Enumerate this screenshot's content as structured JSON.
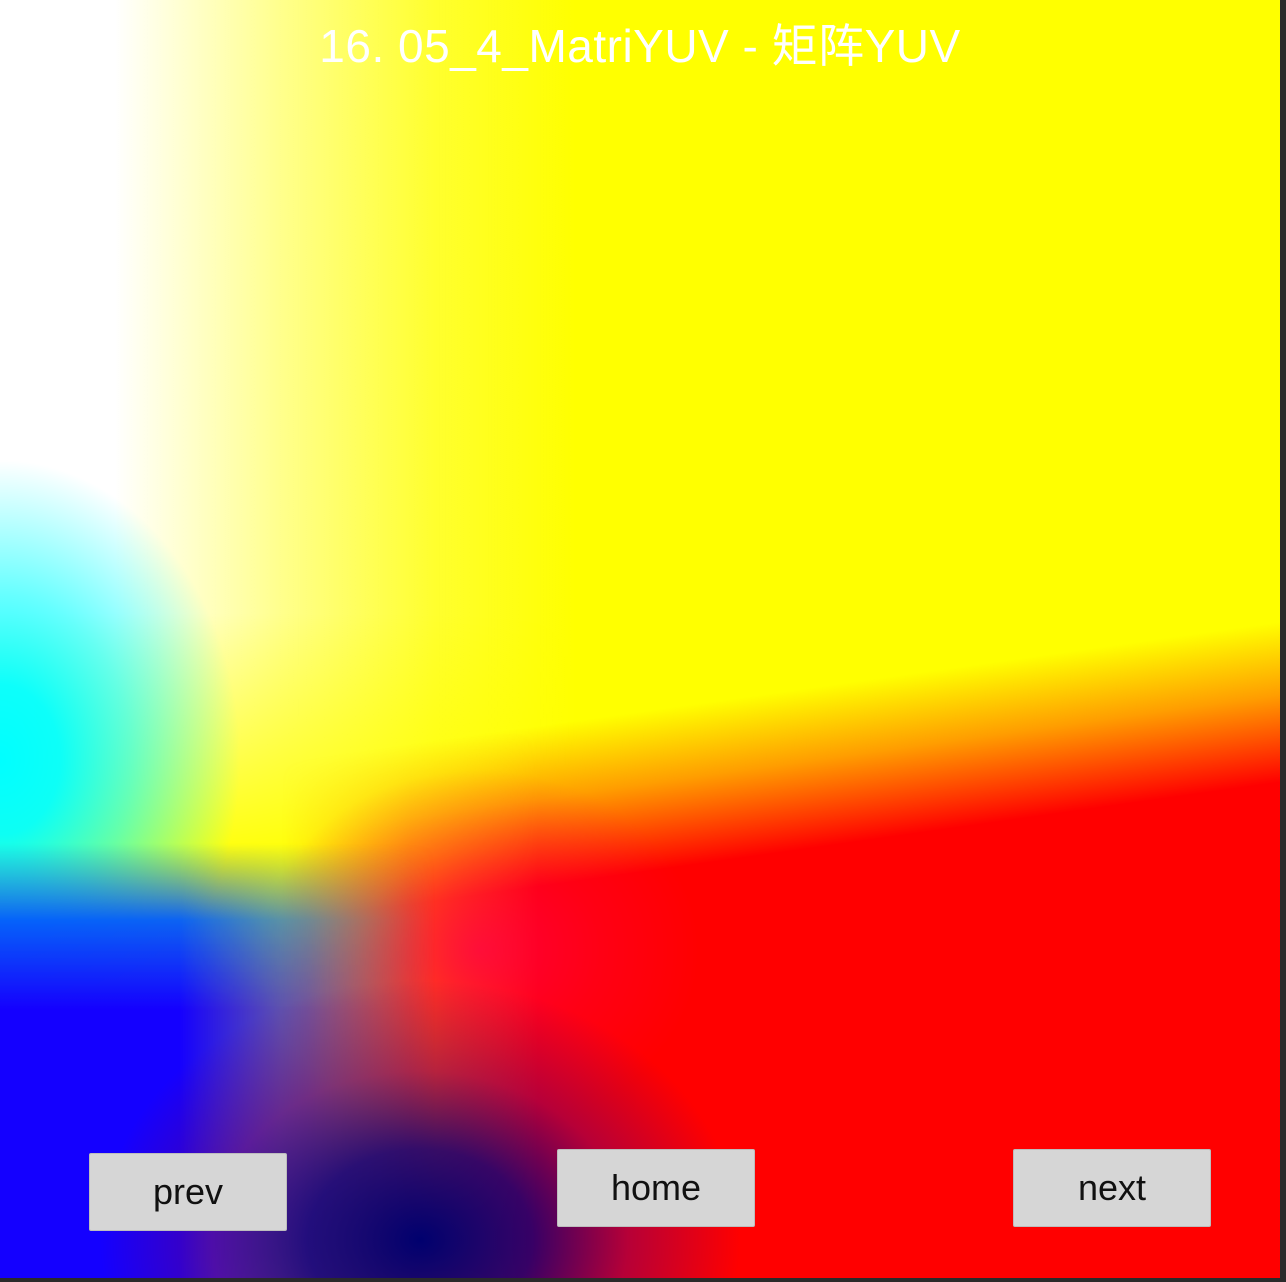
{
  "screen": {
    "title": "16.  05_4_MatriYUV - 矩阵YUV"
  },
  "colors": {
    "yellow": "#ffff00",
    "white": "#ffffff",
    "cyan": "#00ffff",
    "red": "#ff0000",
    "blue": "#1400ff",
    "button_bg": "#d6d6d6"
  },
  "nav": {
    "prev_label": "prev",
    "home_label": "home",
    "next_label": "next"
  }
}
